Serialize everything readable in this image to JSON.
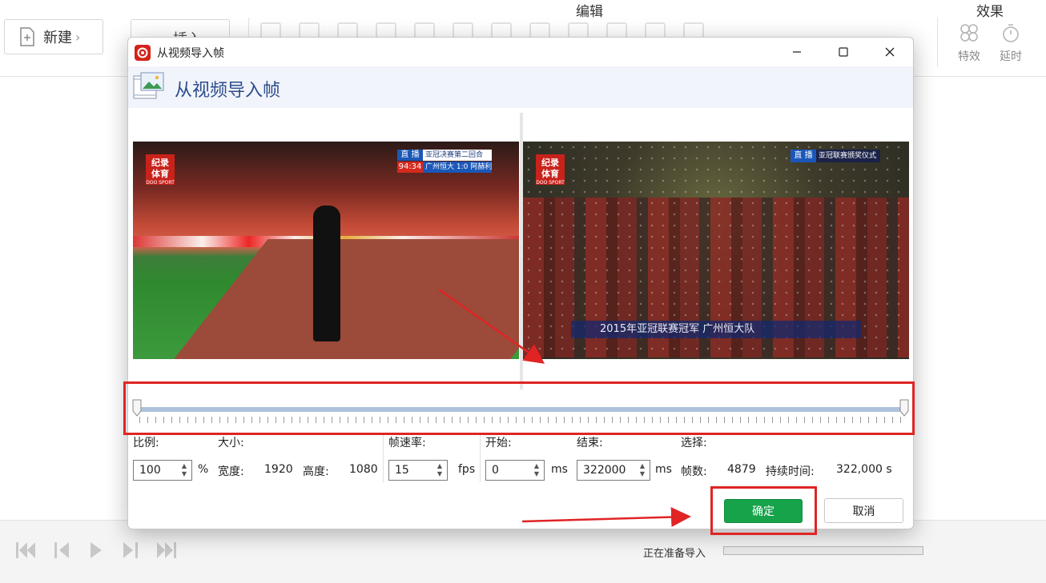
{
  "app": {
    "new_button": "新建",
    "insert_button": "插入",
    "section_edit": "编辑",
    "section_effect": "效果",
    "effect_tools": [
      {
        "label": "特效",
        "icon": "effects-icon"
      },
      {
        "label": "延时",
        "icon": "timer-icon"
      }
    ],
    "status_text": "正在准备导入",
    "progress": 0
  },
  "dialog": {
    "window_title": "从视频导入帧",
    "header_title": "从视频导入帧",
    "preview_left": {
      "logo_line1": "纪录",
      "logo_line2": "体育",
      "logo_sub": "DOO SPORT",
      "live_label": "直 播",
      "match_title": "亚冠决赛第二回合",
      "match_time": "94:34",
      "match_score": "广州恒大 1:0 阿赫利"
    },
    "preview_right": {
      "logo_line1": "纪录",
      "logo_line2": "体育",
      "logo_sub": "DOO SPORT",
      "live_label": "直 播",
      "caption": "亚冠联赛颁奖仪式",
      "banner": "2015年亚冠联赛冠军   广州恒大队"
    },
    "labels": {
      "scale": "比例:",
      "size": "大小:",
      "fps_label": "帧速率:",
      "start": "开始:",
      "end": "结束:",
      "selection": "选择:",
      "width": "宽度:",
      "height": "高度:",
      "frames": "帧数:",
      "duration": "持续时间:"
    },
    "values": {
      "scale": "100",
      "scale_unit": "%",
      "width": "1920",
      "height": "1080",
      "fps": "15",
      "fps_unit": "fps",
      "start": "0",
      "start_unit": "ms",
      "end": "322000",
      "end_unit": "ms",
      "frames": "4879",
      "duration": "322,000 s"
    },
    "ok_button": "确定",
    "cancel_button": "取消"
  },
  "colors": {
    "accent_green": "#16a34a",
    "title_blue": "#2b4d8c",
    "highlight_red": "#e02424"
  }
}
